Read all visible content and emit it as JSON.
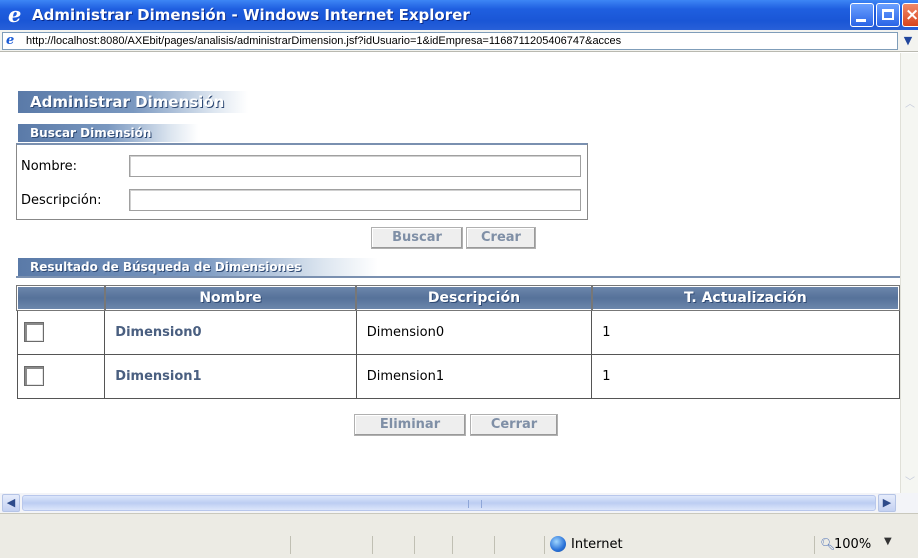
{
  "window": {
    "title": "Administrar Dimensión - Windows Internet Explorer"
  },
  "address": {
    "url": "http://localhost:8080/AXEbit/pages/analisis/administrarDimension.jsf?idUsuario=1&idEmpresa=1168711205406747&acces"
  },
  "page": {
    "title": "Administrar Dimensión",
    "search": {
      "header": "Buscar Dimensión",
      "nombre_label": "Nombre:",
      "nombre_value": "",
      "descripcion_label": "Descripción:",
      "descripcion_value": "",
      "buscar_label": "Buscar",
      "crear_label": "Crear"
    },
    "results": {
      "header": "Resultado de Búsqueda de Dimensiones",
      "columns": [
        "",
        "Nombre",
        "Descripción",
        "T. Actualización"
      ],
      "rows": [
        {
          "checked": false,
          "nombre": "Dimension0",
          "descripcion": "Dimension0",
          "actualizacion": "1"
        },
        {
          "checked": false,
          "nombre": "Dimension1",
          "descripcion": "Dimension1",
          "actualizacion": "1"
        }
      ],
      "eliminar_label": "Eliminar",
      "cerrar_label": "Cerrar"
    }
  },
  "status": {
    "zone": "Internet",
    "zoom": "100%"
  },
  "icons": {
    "window": "ie-logo-icon",
    "address": "page-icon",
    "zone": "globe-icon",
    "zoom": "magnifier-icon"
  },
  "colors": {
    "titlebar": "#1f5fe0",
    "header_band": "#5a7aa8",
    "link": "#4a5f80",
    "disabled_button_text": "#7f8fa6"
  }
}
